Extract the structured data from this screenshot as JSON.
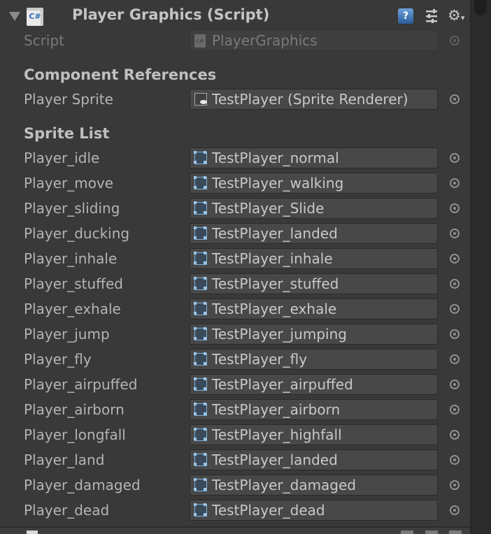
{
  "component": {
    "title": "Player Graphics (Script)",
    "icon_label": "C#",
    "help_label": "?",
    "gear_label": "⚙",
    "dropdown_marker": "▾"
  },
  "script_row": {
    "label": "Script",
    "value": "PlayerGraphics",
    "icon_label": "c#"
  },
  "section_component_references": "Component References",
  "player_sprite": {
    "label": "Player Sprite",
    "value": "TestPlayer (Sprite Renderer)"
  },
  "section_sprite_list": "Sprite List",
  "sprites": [
    {
      "label": "Player_idle",
      "value": "TestPlayer_normal"
    },
    {
      "label": "Player_move",
      "value": "TestPlayer_walking"
    },
    {
      "label": "Player_sliding",
      "value": "TestPlayer_Slide"
    },
    {
      "label": "Player_ducking",
      "value": "TestPlayer_landed"
    },
    {
      "label": "Player_inhale",
      "value": "TestPlayer_inhale"
    },
    {
      "label": "Player_stuffed",
      "value": "TestPlayer_stuffed"
    },
    {
      "label": "Player_exhale",
      "value": "TestPlayer_exhale"
    },
    {
      "label": "Player_jump",
      "value": "TestPlayer_jumping"
    },
    {
      "label": "Player_fly",
      "value": "TestPlayer_fly"
    },
    {
      "label": "Player_airpuffed",
      "value": "TestPlayer_airpuffed"
    },
    {
      "label": "Player_airborn",
      "value": "TestPlayer_airborn"
    },
    {
      "label": "Player_longfall",
      "value": "TestPlayer_highfall"
    },
    {
      "label": "Player_land",
      "value": "TestPlayer_landed"
    },
    {
      "label": "Player_damaged",
      "value": "TestPlayer_damaged"
    },
    {
      "label": "Player_dead",
      "value": "TestPlayer_dead"
    }
  ],
  "colors": {
    "panel": "#393939",
    "field": "#484848",
    "accent": "#2f6fb8"
  }
}
